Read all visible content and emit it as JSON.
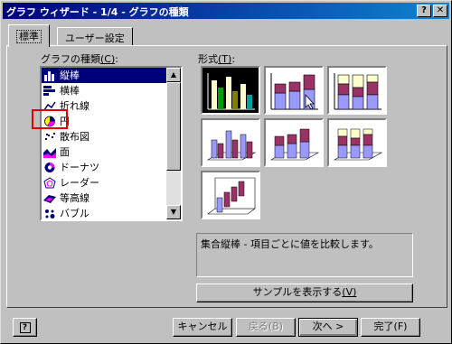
{
  "window": {
    "title": "グラフ ウィザード - 1/4 - グラフの種類",
    "help_glyph": "?",
    "close_glyph": "✕"
  },
  "tabs": [
    {
      "label": "標準"
    },
    {
      "label": "ユーザー設定"
    }
  ],
  "chart_types": {
    "label": "グラフの種類",
    "mnemonic": "(C)",
    "items": [
      {
        "label": "縦棒",
        "icon": "column-chart-icon"
      },
      {
        "label": "横棒",
        "icon": "bar-chart-icon"
      },
      {
        "label": "折れ線",
        "icon": "line-chart-icon"
      },
      {
        "label": "円",
        "icon": "pie-chart-icon"
      },
      {
        "label": "散布図",
        "icon": "scatter-chart-icon"
      },
      {
        "label": "面",
        "icon": "area-chart-icon"
      },
      {
        "label": "ドーナツ",
        "icon": "doughnut-chart-icon"
      },
      {
        "label": "レーダー",
        "icon": "radar-chart-icon"
      },
      {
        "label": "等高線",
        "icon": "surface-chart-icon"
      },
      {
        "label": "バブル",
        "icon": "bubble-chart-icon"
      }
    ],
    "selected": "縦棒"
  },
  "subtype": {
    "label": "形式",
    "mnemonic": "(T)"
  },
  "description": "集合縦棒 - 項目ごとに値を比較します。",
  "sample_button": {
    "label": "サンプルを表示する",
    "mnemonic": "(V)"
  },
  "footer": {
    "help_glyph": "?",
    "cancel": "キャンセル",
    "back": "戻る(B)",
    "next": "次へ >",
    "finish": "完了(F)"
  },
  "colors": {
    "accent": "#00007b",
    "highlight": "#e00000",
    "series1": "#9999ff",
    "series2": "#993366",
    "series3": "#ffffcc"
  }
}
